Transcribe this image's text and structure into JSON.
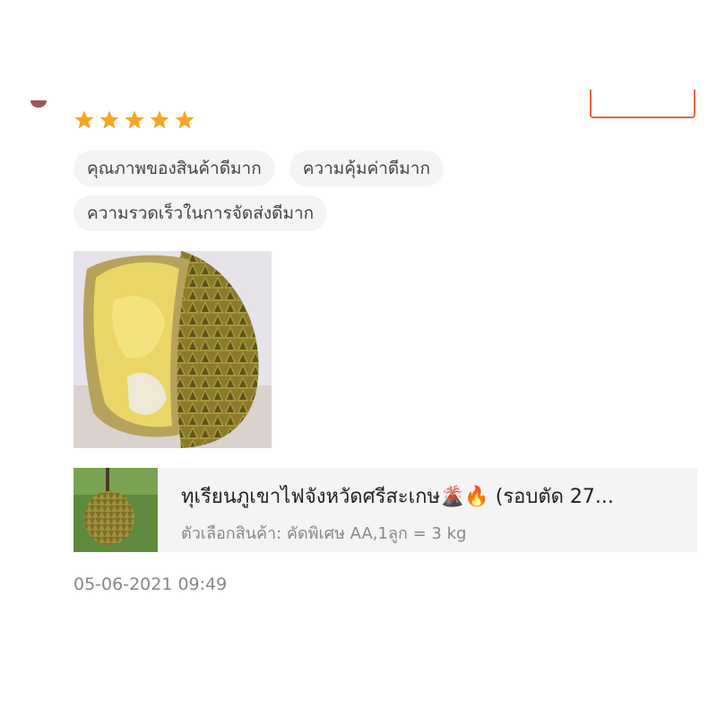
{
  "review": {
    "rating": 5,
    "tags": [
      "คุณภาพของสินค้าดีมาก",
      "ความคุ้มค่าดีมาก",
      "ความรวดเร็วในการจัดส่งดีมาก"
    ],
    "timestamp": "05-06-2021 09:49"
  },
  "product": {
    "name": "ทุเรียนภูเขาไฟจังหวัดศรีสะเกษ🌋🔥 (รอบตัด 27...",
    "variant": "ตัวเลือกสินค้า: คัดพิเศษ AA,1ลูก = 3 kg"
  },
  "colors": {
    "star": "#f6a623",
    "accent": "#e8623f",
    "tag_bg": "#f4f4f4",
    "muted_text": "#888888"
  }
}
